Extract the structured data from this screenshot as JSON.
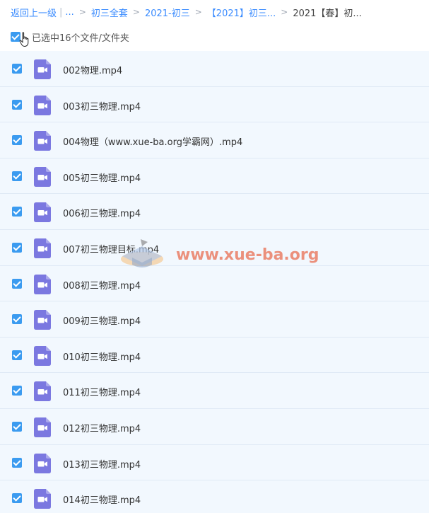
{
  "breadcrumb": {
    "back": "返回上一级",
    "ellipsis": "...",
    "items": [
      "初三全套",
      "2021-初三",
      "【2021】初三...",
      "2021【春】初..."
    ]
  },
  "selection": {
    "label": "已选中16个文件/文件夹",
    "checked": true
  },
  "files": [
    {
      "name": "002物理.mp4",
      "checked": true,
      "icon": "video-file-icon"
    },
    {
      "name": "003初三物理.mp4",
      "checked": true,
      "icon": "video-file-icon"
    },
    {
      "name": "004物理（www.xue-ba.org学霸网）.mp4",
      "checked": true,
      "icon": "video-file-icon"
    },
    {
      "name": "005初三物理.mp4",
      "checked": true,
      "icon": "video-file-icon"
    },
    {
      "name": "006初三物理.mp4",
      "checked": true,
      "icon": "video-file-icon"
    },
    {
      "name": "007初三物理目标.mp4",
      "checked": true,
      "icon": "video-file-icon"
    },
    {
      "name": "008初三物理.mp4",
      "checked": true,
      "icon": "video-file-icon"
    },
    {
      "name": "009初三物理.mp4",
      "checked": true,
      "icon": "video-file-icon"
    },
    {
      "name": "010初三物理.mp4",
      "checked": true,
      "icon": "video-file-icon"
    },
    {
      "name": "011初三物理.mp4",
      "checked": true,
      "icon": "video-file-icon"
    },
    {
      "name": "012初三物理.mp4",
      "checked": true,
      "icon": "video-file-icon"
    },
    {
      "name": "013初三物理.mp4",
      "checked": true,
      "icon": "video-file-icon"
    },
    {
      "name": "014初三物理.mp4",
      "checked": true,
      "icon": "video-file-icon"
    }
  ],
  "watermark": {
    "text": "www.xue-ba.org"
  },
  "colors": {
    "link": "#3b8cff",
    "checkbox": "#3b9bf0",
    "row_bg": "#f2f8fe",
    "video_icon": "#7b78e0"
  }
}
